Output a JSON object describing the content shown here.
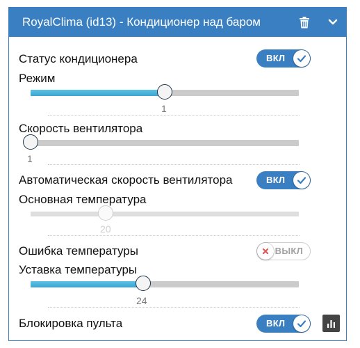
{
  "header": {
    "title": "RoyalClima (id13) - Кондиционер над баром",
    "delete_icon": "trash-icon",
    "collapse_icon": "chevron-down-icon"
  },
  "rows": {
    "ac_status": {
      "label": "Статус кондиционера",
      "toggle_label": "ВКЛ",
      "state": "on"
    },
    "mode": {
      "label": "Режим",
      "value": "1",
      "min": 0,
      "max": 2,
      "fill_fraction": 0.5
    },
    "fan_speed": {
      "label": "Скорость вентилятора",
      "value": "1",
      "min": 1,
      "max": 3,
      "fill_fraction": 0.0
    },
    "auto_fan": {
      "label": "Автоматическая скорость вентилятора",
      "toggle_label": "ВКЛ",
      "state": "on"
    },
    "main_temp": {
      "label": "Основная температура",
      "value": "20",
      "disabled": true,
      "fill_fraction": 0.28
    },
    "temp_error": {
      "label": "Ошибка температуры",
      "toggle_label": "ВЫКЛ",
      "state": "off"
    },
    "setpoint": {
      "label": "Уставка температуры",
      "value": "24",
      "fill_fraction": 0.42
    },
    "remote_lock": {
      "label": "Блокировка пульта",
      "toggle_label": "ВКЛ",
      "state": "on",
      "chart_icon": "bar-chart-icon"
    }
  },
  "colors": {
    "header": "#3a7fc1",
    "toggle_on": "#3a7fc1",
    "slider_fill": "#3ba6d2",
    "check": "#3a7fc1",
    "cross": "#e05a5a"
  }
}
